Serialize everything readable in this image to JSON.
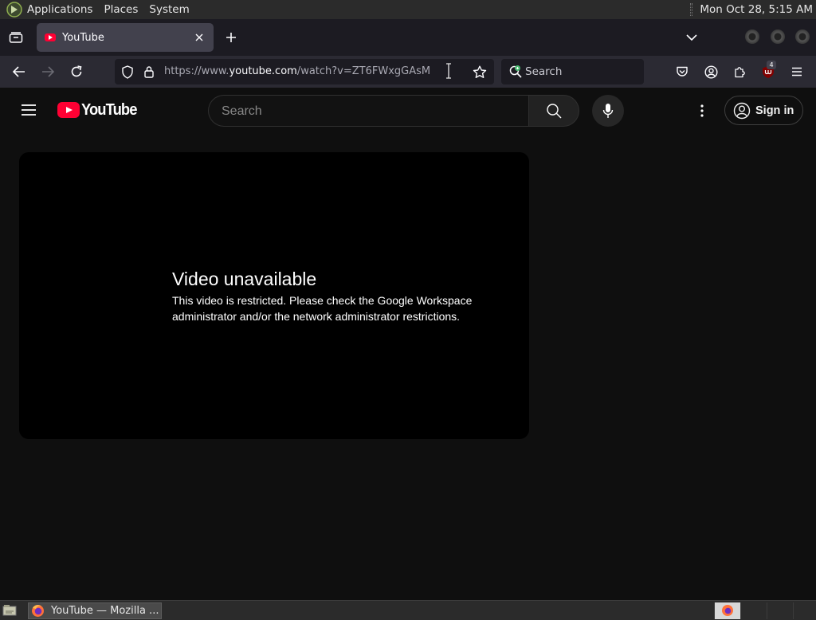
{
  "topbar": {
    "menus": [
      "Applications",
      "Places",
      "System"
    ],
    "clock": "Mon Oct 28,  5:15 AM"
  },
  "browser": {
    "tab": {
      "title": "YouTube"
    },
    "urlbar": {
      "prefix": "https://www.",
      "domain": "youtube.com",
      "path": "/watch?v=ZT6FWxgGAsM"
    },
    "searchbar": {
      "placeholder": "Search"
    },
    "ublock_count": "4"
  },
  "youtube": {
    "logo_text": "YouTube",
    "search_placeholder": "Search",
    "signin_label": "Sign in",
    "error_title": "Video unavailable",
    "error_message": "This video is restricted. Please check the Google Workspace administrator and/or the network administrator restrictions."
  },
  "taskbar": {
    "task_label": "YouTube — Mozilla ..."
  },
  "colors": {
    "youtube_red": "#ff0033",
    "page_bg": "#0f0f0f",
    "toolbar_bg": "#2b2a33"
  }
}
